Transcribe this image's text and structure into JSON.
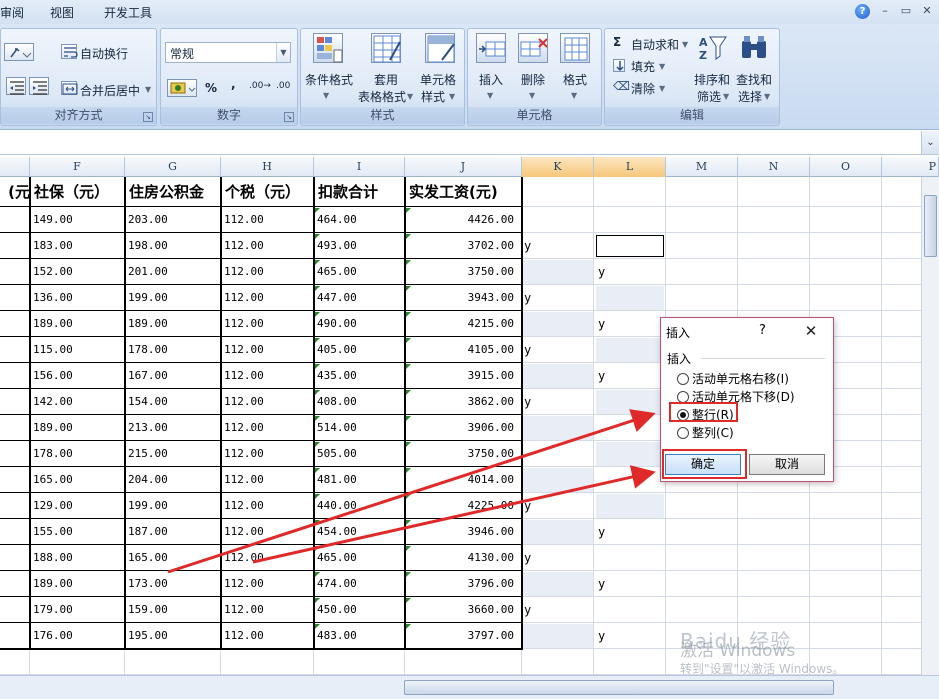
{
  "menubar": {
    "items": [
      "审阅",
      "视图",
      "开发工具"
    ],
    "window_buttons": [
      "–",
      "▭",
      "✕"
    ]
  },
  "ribbon": {
    "alignment": {
      "wrap_text": "自动换行",
      "merge_center": "合并后居中",
      "label": "对齐方式"
    },
    "number": {
      "format_value": "常规",
      "percent": "%",
      "comma": ",",
      "inc_decimal": ".00→",
      "dec_decimal": ".00",
      "label": "数字"
    },
    "styles": {
      "conditional": "条件格式",
      "table_format_1": "套用",
      "table_format_2": "表格格式",
      "cell_style_1": "单元格",
      "cell_style_2": "样式",
      "label": "样式"
    },
    "cells": {
      "insert": "插入",
      "delete": "删除",
      "format": "格式",
      "label": "单元格"
    },
    "editing": {
      "autosum": "自动求和",
      "fill": "填充",
      "clear": "清除",
      "sort_1": "排序和",
      "sort_2": "筛选",
      "find_1": "查找和",
      "find_2": "选择",
      "label": "编辑"
    }
  },
  "columns": [
    "F",
    "G",
    "H",
    "I",
    "J",
    "K",
    "L",
    "M",
    "N",
    "O",
    "P"
  ],
  "table": {
    "headers": [
      "元)",
      "社保（元）",
      "住房公积金",
      "个税（元）",
      "扣款合计",
      "实发工资(元)"
    ],
    "rows": [
      [
        "149.00",
        "203.00",
        "112.00",
        "464.00",
        "4426.00"
      ],
      [
        "183.00",
        "198.00",
        "112.00",
        "493.00",
        "3702.00"
      ],
      [
        "152.00",
        "201.00",
        "112.00",
        "465.00",
        "3750.00"
      ],
      [
        "136.00",
        "199.00",
        "112.00",
        "447.00",
        "3943.00"
      ],
      [
        "189.00",
        "189.00",
        "112.00",
        "490.00",
        "4215.00"
      ],
      [
        "115.00",
        "178.00",
        "112.00",
        "405.00",
        "4105.00"
      ],
      [
        "156.00",
        "167.00",
        "112.00",
        "435.00",
        "3915.00"
      ],
      [
        "142.00",
        "154.00",
        "112.00",
        "408.00",
        "3862.00"
      ],
      [
        "189.00",
        "213.00",
        "112.00",
        "514.00",
        "3906.00"
      ],
      [
        "178.00",
        "215.00",
        "112.00",
        "505.00",
        "3750.00"
      ],
      [
        "165.00",
        "204.00",
        "112.00",
        "481.00",
        "4014.00"
      ],
      [
        "129.00",
        "199.00",
        "112.00",
        "440.00",
        "4225.00"
      ],
      [
        "155.00",
        "187.00",
        "112.00",
        "454.00",
        "3946.00"
      ],
      [
        "188.00",
        "165.00",
        "112.00",
        "465.00",
        "4130.00"
      ],
      [
        "189.00",
        "173.00",
        "112.00",
        "474.00",
        "3796.00"
      ],
      [
        "179.00",
        "159.00",
        "112.00",
        "450.00",
        "3660.00"
      ],
      [
        "176.00",
        "195.00",
        "112.00",
        "483.00",
        "3797.00"
      ]
    ],
    "k_marks": [
      "",
      "y",
      "",
      "y",
      "",
      "y",
      "",
      "y",
      "",
      "",
      "",
      "y",
      "",
      "y",
      "",
      "y",
      ""
    ],
    "l_marks": [
      "",
      "",
      "y",
      "",
      "y",
      "",
      "y",
      "",
      "",
      "",
      "",
      "",
      "y",
      "",
      "y",
      "",
      "y"
    ]
  },
  "dialog": {
    "title": "插入",
    "help": "?",
    "close": "✕",
    "group_label": "插入",
    "options": [
      {
        "label": "活动单元格右移(I)",
        "checked": false
      },
      {
        "label": "活动单元格下移(D)",
        "checked": false
      },
      {
        "label": "整行(R)",
        "checked": true
      },
      {
        "label": "整列(C)",
        "checked": false
      }
    ],
    "ok": "确定",
    "cancel": "取消"
  },
  "overlay": {
    "annotation_color": "#e02a2a",
    "watermark": "Baidu 经验",
    "activate_title": "激活 Windows",
    "activate_sub": "转到\"设置\"以激活 Windows。"
  }
}
